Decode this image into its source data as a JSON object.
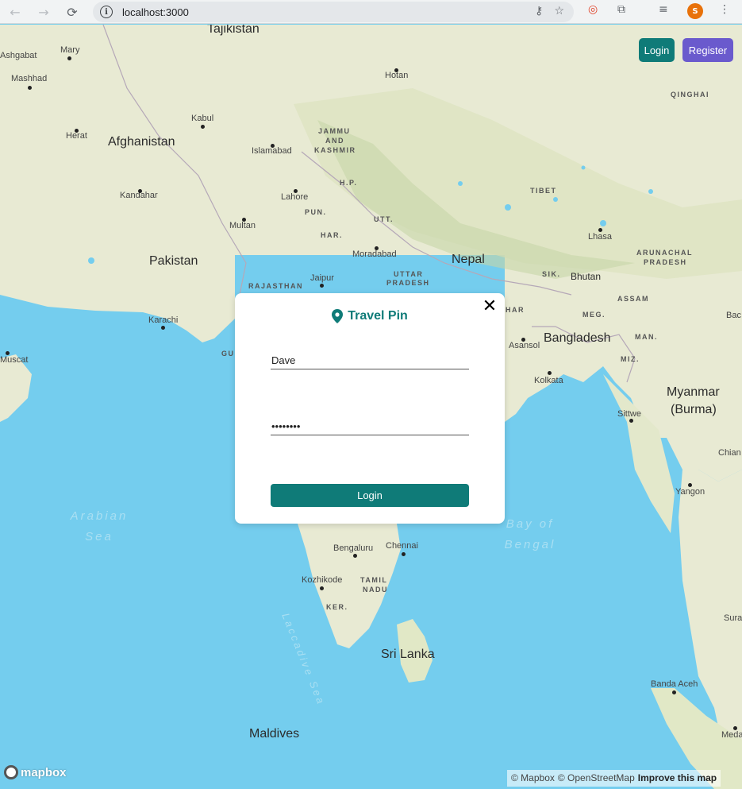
{
  "browser": {
    "url": "localhost:3000",
    "avatar_letter": "S",
    "icons": [
      "back-arrow-icon",
      "forward-arrow-icon",
      "reload-icon",
      "site-info-icon",
      "key-icon",
      "star-icon",
      "extension-icon",
      "puzzle-icon",
      "media-icon",
      "kebab-menu-icon"
    ]
  },
  "header": {
    "login_label": "Login",
    "register_label": "Register"
  },
  "modal": {
    "title": "Travel Pin",
    "close_symbol": "✕",
    "username_value": "Dave",
    "password_value": "••••••••",
    "submit_label": "Login"
  },
  "map": {
    "countries": [
      "Tajikistan",
      "Afghanistan",
      "Pakistan",
      "Nepal",
      "Bangladesh",
      "Myanmar",
      "(Burma)",
      "Sri Lanka",
      "Maldives"
    ],
    "regions": [
      "JAMMU",
      "AND",
      "KASHMIR",
      "H.P.",
      "PUN.",
      "HAR.",
      "UTT.",
      "UTTAR",
      "PRADESH",
      "RAJASTHAN",
      "QINGHAI",
      "TIBET",
      "ARUNACHAL",
      "PRADESH",
      "SIK.",
      "ASSAM",
      "MEG.",
      "MAN.",
      "MIZ.",
      "TAMIL",
      "NADU",
      "KER.",
      "GU",
      "HAR"
    ],
    "cities": [
      "Ashgabat",
      "Mary",
      "Mashhad",
      "Herat",
      "Kabul",
      "Kandahar",
      "Islamabad",
      "Lahore",
      "Multan",
      "Karachi",
      "Jaipur",
      "Moradabad",
      "Hotan",
      "Lhasa",
      "Bhutan",
      "Asansol",
      "Kolkata",
      "Sittwe",
      "Yangon",
      "Bengaluru",
      "Chennai",
      "Kozhikode",
      "Banda Aceh",
      "Muscat",
      "Chian",
      "Bac",
      "Sura",
      "Meda"
    ],
    "seas": [
      "Arabian Sea",
      "Bay of Bengal",
      "Laccadive Sea"
    ]
  },
  "attribution": {
    "logo_text": "mapbox",
    "copyright_mapbox": "© Mapbox",
    "copyright_osm": "© OpenStreetMap",
    "improve_link": "Improve this map"
  },
  "colors": {
    "teal": "#0f7b78",
    "purple": "#6a5acd",
    "ocean": "#74cdee",
    "land": "#e8ead3"
  }
}
